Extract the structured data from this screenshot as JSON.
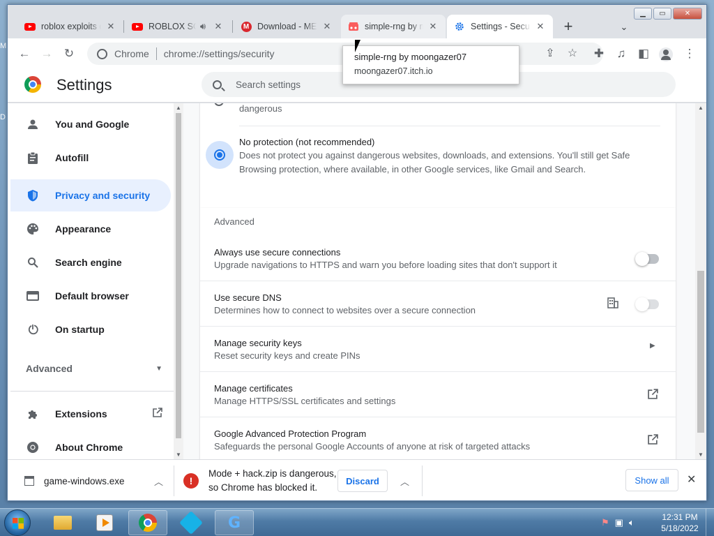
{
  "desktop": {
    "side_letters": [
      "M",
      "D"
    ]
  },
  "tabs": [
    {
      "title": "roblox exploits d",
      "icon": "youtube-icon",
      "active": false
    },
    {
      "title": "ROBLOX SCR",
      "icon": "youtube-icon",
      "active": false,
      "audio": true
    },
    {
      "title": "Download - MEG",
      "icon": "mega-icon",
      "active": false
    },
    {
      "title": "simple-rng by m",
      "icon": "itch-icon",
      "active": false
    },
    {
      "title": "Settings - Securit",
      "icon": "settings-gear-icon",
      "active": true
    }
  ],
  "tab_close_glyph": "✕",
  "new_tab_glyph": "+",
  "tooltip": {
    "title": "simple-rng by moongazer07",
    "domain": "moongazer07.itch.io"
  },
  "omnibox": {
    "site_label": "Chrome",
    "url": "chrome://settings/security"
  },
  "settings": {
    "title": "Settings",
    "search_placeholder": "Search settings"
  },
  "sidebar": {
    "items": [
      {
        "label": "You and Google",
        "icon": "person-icon"
      },
      {
        "label": "Autofill",
        "icon": "clipboard-icon"
      },
      {
        "label": "Privacy and security",
        "icon": "shield-icon",
        "active": true
      },
      {
        "label": "Appearance",
        "icon": "palette-icon"
      },
      {
        "label": "Search engine",
        "icon": "search-icon"
      },
      {
        "label": "Default browser",
        "icon": "browser-window-icon"
      },
      {
        "label": "On startup",
        "icon": "power-icon"
      }
    ],
    "advanced_label": "Advanced",
    "extensions_label": "Extensions",
    "about_label": "About Chrome"
  },
  "main": {
    "partial_text": "dangerous",
    "no_protection": {
      "title": "No protection (not recommended)",
      "desc_line1": "Does not protect you against dangerous websites, downloads, and extensions. You'll still get Safe",
      "desc_line2": "Browsing protection, where available, in other Google services, like Gmail and Search."
    },
    "advanced_header": "Advanced",
    "rows": [
      {
        "title": "Always use secure connections",
        "desc": "Upgrade navigations to HTTPS and warn you before loading sites that don't support it",
        "control": "toggle"
      },
      {
        "title": "Use secure DNS",
        "desc": "Determines how to connect to websites over a secure connection",
        "control": "toggle-disabled"
      },
      {
        "title": "Manage security keys",
        "desc": "Reset security keys and create PINs",
        "control": "arrow"
      },
      {
        "title": "Manage certificates",
        "desc": "Manage HTTPS/SSL certificates and settings",
        "control": "external"
      },
      {
        "title": "Google Advanced Protection Program",
        "desc": "Safeguards the personal Google Accounts of anyone at risk of targeted attacks",
        "control": "external"
      }
    ]
  },
  "downloads": {
    "file1": "game-windows.exe",
    "warning_line1": "Mode + hack.zip is dangerous,",
    "warning_line2": "so Chrome has blocked it.",
    "discard_label": "Discard",
    "show_all_label": "Show all"
  },
  "taskbar": {
    "time": "12:31 PM",
    "date": "5/18/2022"
  },
  "colors": {
    "accent": "#1a73e8",
    "danger": "#d93025",
    "active_nav_bg": "#e8f0fe"
  }
}
